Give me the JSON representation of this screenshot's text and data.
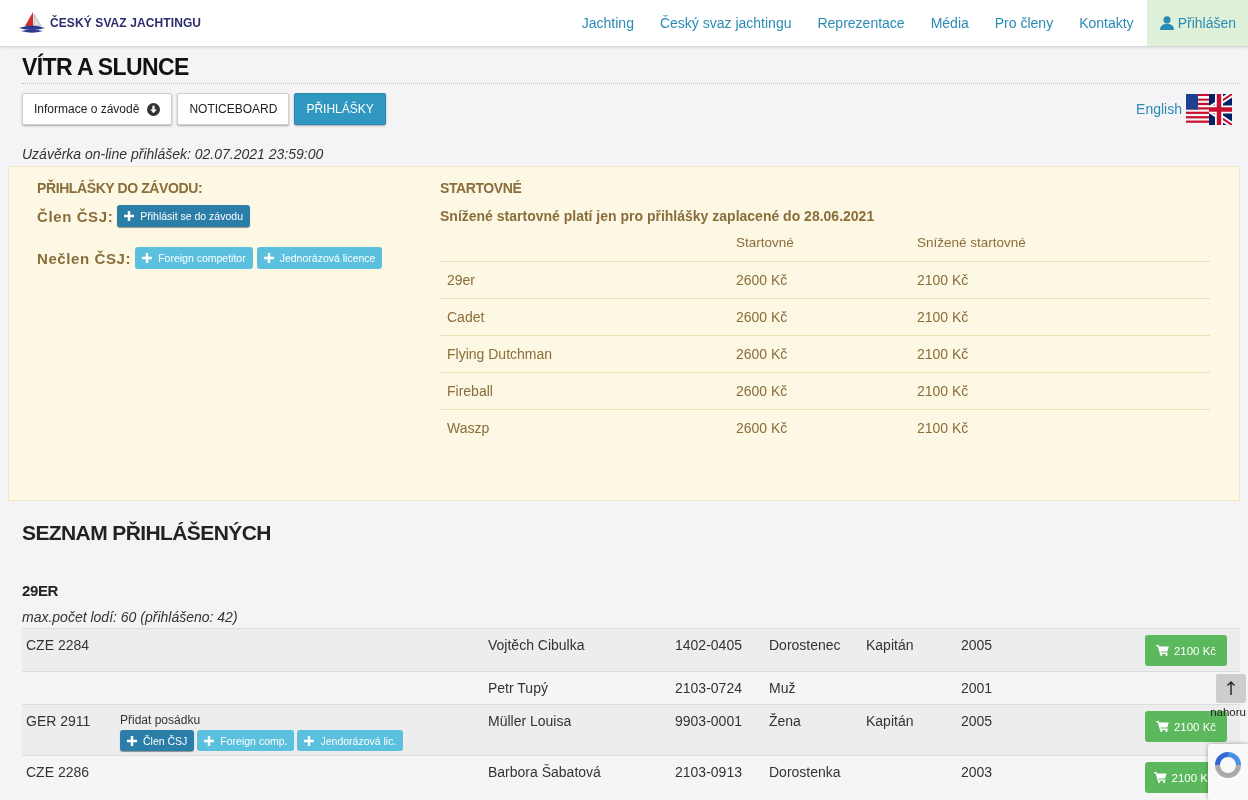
{
  "header": {
    "logo_text": "ČESKÝ SVAZ JACHTINGU",
    "nav": [
      {
        "label": "Jachting",
        "kind": "link"
      },
      {
        "label": "Český svaz jachtingu",
        "kind": "link"
      },
      {
        "label": "Reprezentace",
        "kind": "link"
      },
      {
        "label": "Média",
        "kind": "link"
      },
      {
        "label": "Pro členy",
        "kind": "link"
      },
      {
        "label": "Kontakty",
        "kind": "link"
      },
      {
        "label": "Přihlášen",
        "kind": "account"
      }
    ]
  },
  "page": {
    "title": "VÍTR A SLUNCE",
    "tabs": [
      {
        "label": "Informace o závodě",
        "kind": "dropdown",
        "selected": false
      },
      {
        "label": "NOTICEBOARD",
        "kind": "plain",
        "selected": false
      },
      {
        "label": "PŘIHLÁŠKY",
        "kind": "plain",
        "selected": true
      }
    ],
    "language_link": "English",
    "deadline": "Uzávěrka on-line přihlášek: 02.07.2021 23:59:00"
  },
  "registration": {
    "title": "PŘIHLÁŠKY DO ZÁVODU:",
    "groups": [
      {
        "label": "Člen ČSJ:",
        "buttons": [
          {
            "label": "Přihlásit se do závodu",
            "kind": "primary"
          }
        ]
      },
      {
        "label": "Nečlen ČSJ:",
        "buttons": [
          {
            "label": "Foreign competitor",
            "kind": "info"
          },
          {
            "label": "Jednorázová licence",
            "kind": "info"
          }
        ]
      }
    ]
  },
  "fees": {
    "title": "STARTOVNÉ",
    "note": "Snížené startovné platí jen pro přihlášky zaplacené do 28.06.2021",
    "columns": [
      "",
      "Startovné",
      "Snížené startovné"
    ],
    "rows": [
      [
        "29er",
        "2600 Kč",
        "2100 Kč"
      ],
      [
        "Cadet",
        "2600 Kč",
        "2100 Kč"
      ],
      [
        "Flying Dutchman",
        "2600 Kč",
        "2100 Kč"
      ],
      [
        "Fireball",
        "2600 Kč",
        "2100 Kč"
      ],
      [
        "Waszp",
        "2600 Kč",
        "2100 Kč"
      ]
    ]
  },
  "entries": {
    "title": "SEZNAM PŘIHLÁŠENÝCH",
    "classes": [
      {
        "name": "29ER",
        "capacity": "max.počet lodí: 60 (přihlášeno: 42)",
        "rows": [
          {
            "sail": "CZE 2284",
            "name": "Vojtěch Cibulka",
            "member_id": "1402-0405",
            "category": "Dorostenec",
            "role": "Kapitán",
            "year": "2005",
            "pay_button": {
              "label": "2100 Kč",
              "cut": false
            }
          },
          {
            "name": "Petr Tupý",
            "member_id": "2103-0724",
            "category": "Muž",
            "year": "2001"
          },
          {
            "sail": "GER 2911",
            "add_crew": {
              "label": "Přidat posádku",
              "buttons": [
                {
                  "label": "Člen ČSJ",
                  "kind": "primary"
                },
                {
                  "label": "Foreign comp.",
                  "kind": "info"
                },
                {
                  "label": "Jendorázová lic.",
                  "kind": "info"
                }
              ]
            },
            "name": "Müller Louisa",
            "member_id": "9903-0001",
            "category": "Žena",
            "role": "Kapitán",
            "year": "2005",
            "pay_button": {
              "label": "2100 Kč",
              "cut": false
            }
          },
          {
            "sail": "CZE 2286",
            "name": "Barbora Šabatová",
            "member_id": "2103-0913",
            "category": "Dorostenka",
            "year": "2003",
            "pay_button": {
              "label": "2100 K",
              "cut": true
            }
          }
        ]
      }
    ]
  },
  "scroll_top": {
    "label": "nahoru"
  }
}
